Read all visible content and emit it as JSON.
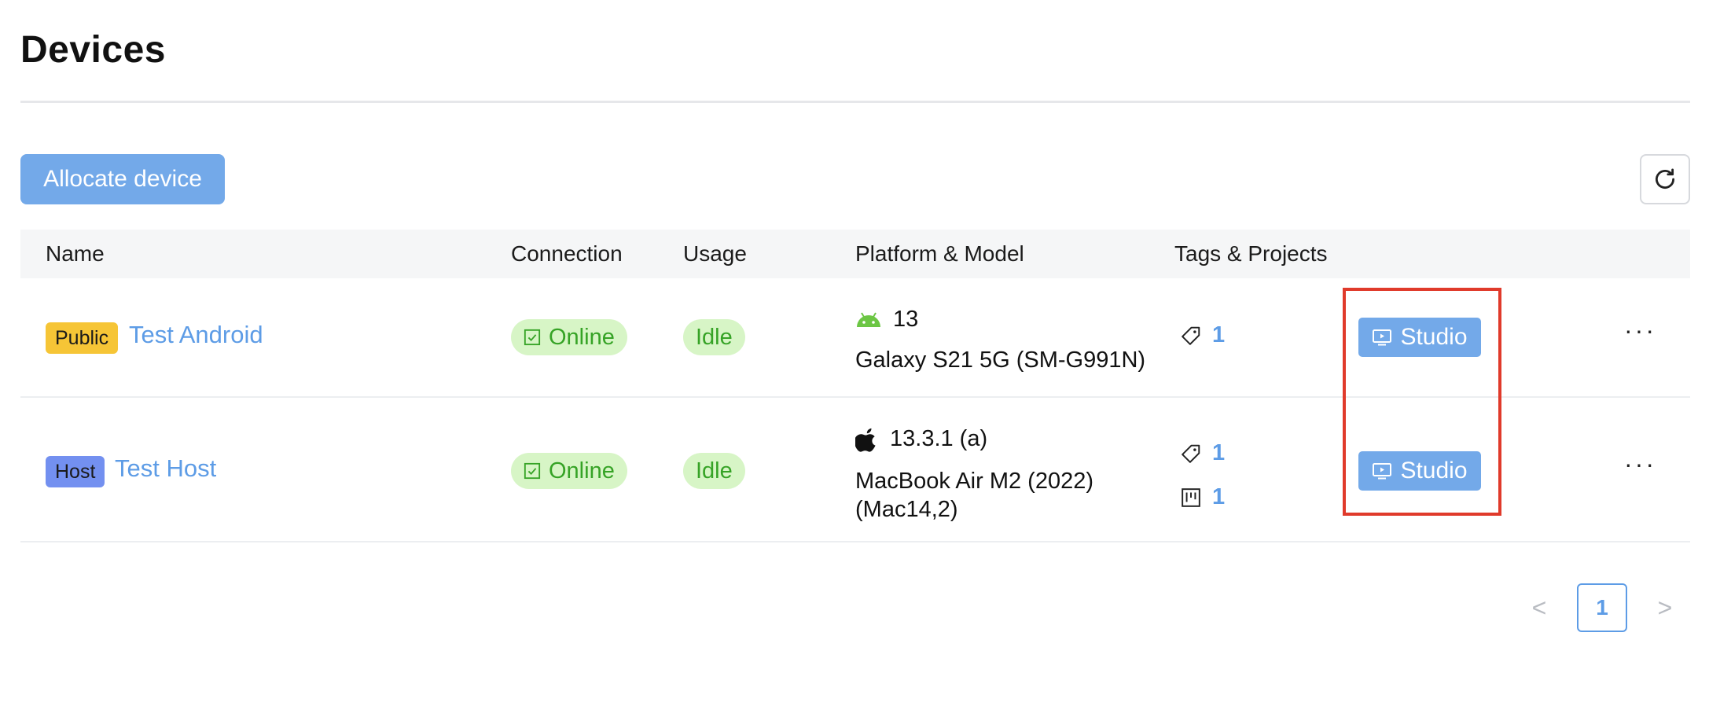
{
  "page": {
    "title": "Devices"
  },
  "toolbar": {
    "allocate_label": "Allocate device",
    "refresh_icon": "refresh-icon"
  },
  "table": {
    "headers": {
      "name": "Name",
      "connection": "Connection",
      "usage": "Usage",
      "platform": "Platform & Model",
      "tags": "Tags & Projects"
    },
    "rows": [
      {
        "badge": "Public",
        "badge_color": "#f6c536",
        "name": "Test Android",
        "connection": "Online",
        "usage": "Idle",
        "platform_icon": "android-icon",
        "platform_version": "13",
        "model": "Galaxy S21 5G (SM-G991N)",
        "tags_count": "1",
        "action_label": "Studio",
        "more": "···"
      },
      {
        "badge": "Host",
        "badge_color": "#7390f0",
        "name": "Test Host",
        "connection": "Online",
        "usage": "Idle",
        "platform_icon": "apple-icon",
        "platform_version": "13.3.1 (a)",
        "model": "MacBook Air M2 (2022) (Mac14,2)",
        "tags_count": "1",
        "projects_count": "1",
        "action_label": "Studio",
        "more": "···"
      }
    ]
  },
  "pagination": {
    "prev": "<",
    "current": "1",
    "next": ">"
  },
  "colors": {
    "accent": "#73a9e9",
    "link": "#5d9ce6",
    "online_bg": "#d7f5c6",
    "online_text": "#36a326",
    "highlight": "#e03a2b"
  }
}
